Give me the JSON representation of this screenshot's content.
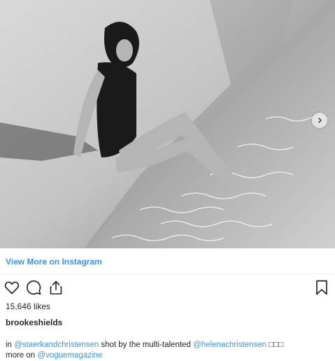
{
  "post": {
    "view_more_label": "View More on Instagram",
    "likes": "15,646 likes",
    "username": "brookeshields",
    "caption": {
      "prefix": "in ",
      "mention_1": "@staerkandchristensen",
      "middle": " shot by the multi-talented ",
      "mention_2": "@helenachristensen",
      "emoji": " □□□",
      "line2_prefix": "more on ",
      "mention_3": "@voguemagazine"
    }
  },
  "icons": {
    "like": "heart-icon",
    "comment": "comment-icon",
    "share": "share-icon",
    "save": "bookmark-icon",
    "next": "chevron-right-icon"
  },
  "colors": {
    "link": "#3897f0",
    "text": "#262626",
    "divider": "#efefef"
  }
}
